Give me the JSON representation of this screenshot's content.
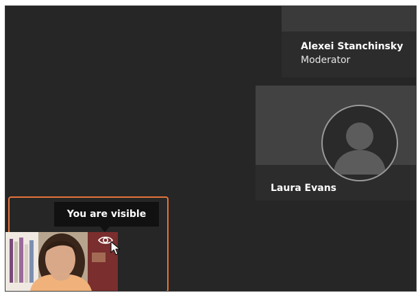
{
  "participants": [
    {
      "name": "Alexei Stanchinsky",
      "role": "Moderator"
    },
    {
      "name": "Laura Evans",
      "role": ""
    }
  ],
  "self_view": {
    "tooltip": "You are visible",
    "visibility_icon": "eye-icon",
    "highlight_color": "#e8743b"
  }
}
